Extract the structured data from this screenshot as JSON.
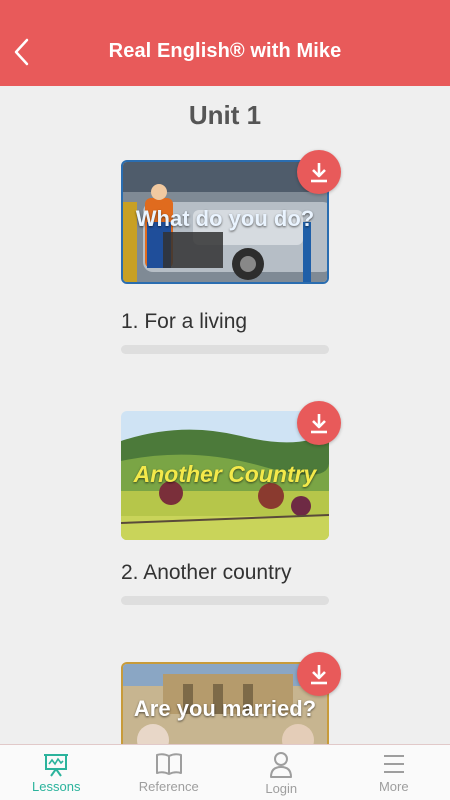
{
  "header": {
    "title": "Real English® with Mike",
    "back_icon": "back-chevron-icon"
  },
  "unit": {
    "title": "Unit 1"
  },
  "lessons": [
    {
      "thumbnail_text": "What do you do?",
      "label": "1. For a living",
      "progress": 0,
      "download_icon": "download-icon"
    },
    {
      "thumbnail_text": "Another Country",
      "label": "2. Another country",
      "progress": 0,
      "download_icon": "download-icon"
    },
    {
      "thumbnail_text": "Are you married?",
      "label": "",
      "progress": 0,
      "download_icon": "download-icon"
    }
  ],
  "bottom_nav": [
    {
      "label": "Lessons",
      "icon": "presentation-board-icon",
      "active": true
    },
    {
      "label": "Reference",
      "icon": "book-icon",
      "active": false
    },
    {
      "label": "Login",
      "icon": "user-icon",
      "active": false
    },
    {
      "label": "More",
      "icon": "menu-icon",
      "active": false
    }
  ],
  "colors": {
    "accent": "#e85a5a",
    "active_tab": "#2bb39c",
    "inactive_tab": "#9e9e9e",
    "background": "#efefef"
  }
}
